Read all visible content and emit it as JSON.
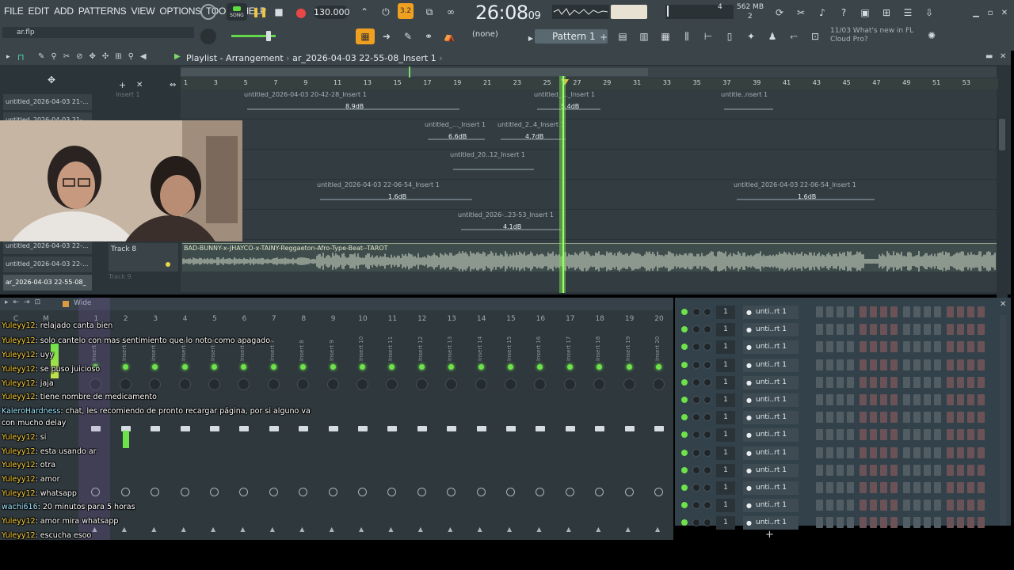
{
  "menu": [
    "FILE",
    "EDIT",
    "ADD",
    "PATTERNS",
    "VIEW",
    "OPTIONS",
    "TOOLS",
    "HELP"
  ],
  "transport": {
    "song_label": "SONG",
    "tempo": "130.000",
    "clock": "26:08",
    "clock_sub": "09"
  },
  "cpu": {
    "line1": "4",
    "mem": "562 MB",
    "line3": "2"
  },
  "pattern": {
    "selector": "(none)",
    "name": "Pattern 1"
  },
  "news": "11/03  What's new in FL Cloud Pro?",
  "file": "ar.flp",
  "playlist": {
    "title": "Playlist - Arrangement",
    "arrangement": "ar_2026-04-03 22-55-08_Insert 1",
    "ruler_ticks": [
      "1",
      "3",
      "5",
      "7",
      "9",
      "11",
      "13",
      "15",
      "17",
      "19",
      "21",
      "23",
      "25",
      "27",
      "29",
      "31",
      "33",
      "35",
      "37",
      "39",
      "41",
      "43",
      "45",
      "47",
      "49",
      "51",
      "53"
    ],
    "side_top": [
      "untitled_2026-04-03 21-...",
      "untitled_2026-04-03 21-..."
    ],
    "side_bottom": [
      "untitled_2026-04-03 22-...",
      "untitled_2026-04-03 22-...",
      "ar_2026-04-03 22-55-08_"
    ],
    "lane_label": "Insert 1",
    "clips": [
      {
        "title": "untitled_2026-04-03 20-42-28_Insert 1",
        "gain": "8.9dB"
      },
      {
        "title": "untitled_..._Insert 1",
        "gain": "5.4dB"
      },
      {
        "title": "untitle..nsert 1",
        "gain": ""
      },
      {
        "title": "untitled_..._Insert 1",
        "gain": "6.6dB"
      },
      {
        "title": "untitled_2..4_Insert 1",
        "gain": "4.7dB"
      },
      {
        "title": "untitled_20..12_Insert 1",
        "gain": ""
      },
      {
        "title": "untitled_2026-04-03 22-06-54_Insert 1",
        "gain": "1.6dB"
      },
      {
        "title": "untitled_2026-04-03 22-06-54_Insert 1",
        "gain": "1.6dB"
      },
      {
        "title": "untitled_2026-..23-53_Insert 1",
        "gain": "4.1dB"
      }
    ],
    "track8": {
      "name": "Track 8",
      "next": "Track 9",
      "clip": "BAD-BUNNY-x-JHAYCO-x-TAINY-Reggaeton-Afro-Type-Beat--TAROT"
    }
  },
  "mixer": {
    "label": "Wide",
    "numbers": [
      "C",
      "M",
      "1",
      "2",
      "3",
      "4",
      "5",
      "6",
      "7",
      "8",
      "9",
      "10",
      "11",
      "12",
      "13",
      "14",
      "15",
      "16",
      "17",
      "18",
      "19",
      "20"
    ],
    "names": [
      "Insert 1",
      "Insert 2",
      "Insert 3",
      "Insert 4",
      "Insert 5",
      "Insert 6",
      "Insert 7",
      "Insert 8",
      "Insert 9",
      "Insert 10",
      "Insert 11",
      "Insert 12",
      "Insert 13",
      "Insert 14",
      "Insert 15",
      "Insert 16",
      "Insert 17",
      "Insert 18",
      "Insert 19",
      "Insert 20"
    ]
  },
  "chat": [
    {
      "user": "Yuleyy12",
      "msg": ": relajado canta bien"
    },
    {
      "user": "Yuleyy12",
      "msg": ": solo cantelo con mas sentimiento que lo noto como apagado"
    },
    {
      "user": "Yuleyy12",
      "msg": ": uyy"
    },
    {
      "user": "Yuleyy12",
      "msg": ": se puso juicioso"
    },
    {
      "user": "Yuleyy12",
      "msg": ": jaja"
    },
    {
      "user": "Yuleyy12",
      "msg": ": tiene nombre de medicamento"
    },
    {
      "user": "KaleroHardness",
      "msg": ": chat, les recomiendo de pronto recargar página, por si alguno va"
    },
    {
      "user": "",
      "msg": "con mucho delay"
    },
    {
      "user": "Yuleyy12",
      "msg": ": si"
    },
    {
      "user": "Yuleyy12",
      "msg": ": esta usando ar"
    },
    {
      "user": "Yuleyy12",
      "msg": ": otra"
    },
    {
      "user": "Yuleyy12",
      "msg": ": amor"
    },
    {
      "user": "Yuleyy12",
      "msg": ": whatsapp"
    },
    {
      "user": "wachi616",
      "msg": ": 20 minutos para 5 horas"
    },
    {
      "user": "Yuleyy12",
      "msg": ": amor mira whatsapp"
    },
    {
      "user": "Yuleyy12",
      "msg": ": escucha esoo"
    }
  ],
  "rack": {
    "rows": [
      {
        "num": "1",
        "name": "unti..rt 1"
      },
      {
        "num": "1",
        "name": "unti..rt 1"
      },
      {
        "num": "1",
        "name": "unti..rt 1"
      },
      {
        "num": "1",
        "name": "unti..rt 1"
      },
      {
        "num": "1",
        "name": "unti..rt 1"
      },
      {
        "num": "1",
        "name": "unti..rt 1"
      },
      {
        "num": "1",
        "name": "unti..rt 1"
      },
      {
        "num": "1",
        "name": "unti..rt 1"
      },
      {
        "num": "1",
        "name": "unti..rt 1"
      },
      {
        "num": "1",
        "name": "unti..rt 1"
      },
      {
        "num": "1",
        "name": "unti..rt 1"
      },
      {
        "num": "1",
        "name": "unti..rt 1"
      },
      {
        "num": "1",
        "name": "unti..rt 1"
      }
    ],
    "add_label": "+"
  },
  "colors": {
    "playhead": "#9cff6a",
    "led": "#6ee24a",
    "chat_user": "#ffd23a",
    "step_dark": "#525c63",
    "step_red": "#6b5256"
  }
}
